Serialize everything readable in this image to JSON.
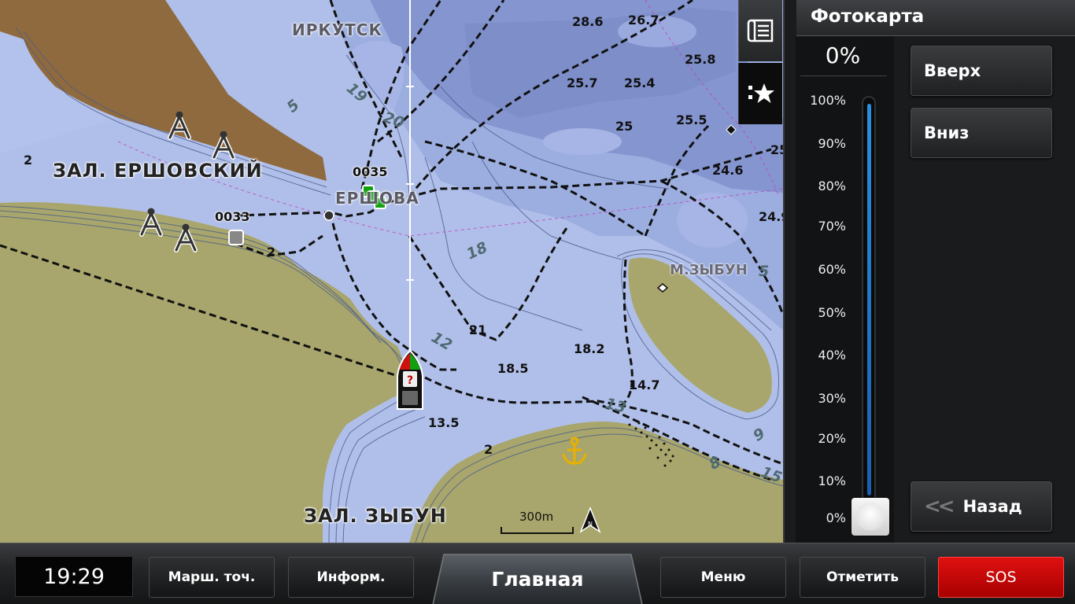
{
  "map": {
    "towns": {
      "irkutsk": "ИРКУТСК",
      "ershova": "ЕРШОВА"
    },
    "bays": {
      "ershovsky": "ЗАЛ. ЕРШОВСКИЙ",
      "zybun": "ЗАЛ. ЗЫБУН"
    },
    "capes": {
      "zybun": "М.ЗЫБУН"
    },
    "waypoints": {
      "wp1": "0035",
      "wp2": "0033"
    },
    "depths": [
      "28.6",
      "26.7",
      "25.8",
      "25.7",
      "25.4",
      "25",
      "25.5",
      "24.6",
      "25",
      "24.9",
      "21",
      "18.2",
      "18.5",
      "14.7",
      "13.5",
      "2",
      "2",
      "2"
    ],
    "contours": [
      "5",
      "19",
      "20",
      "18",
      "12",
      "13",
      "9",
      "8",
      "15",
      "5"
    ],
    "scale": "300m",
    "colors": {
      "water_deep": "#8798d0",
      "water_mid": "#9fb0e0",
      "water_shallow": "#b2c1ec",
      "land": "#a8a66c",
      "photo_land": "#8f6a3e"
    }
  },
  "side_tabs": {
    "layers": "layers-icon",
    "favorites": "favorites-icon"
  },
  "panel": {
    "title": "Фотокарта",
    "percent": "0%",
    "ticks": [
      "100%",
      "90%",
      "80%",
      "70%",
      "60%",
      "50%",
      "40%",
      "30%",
      "20%",
      "10%",
      "0%"
    ],
    "level": 0,
    "up_label": "Вверх",
    "down_label": "Вниз",
    "back_label": "Назад"
  },
  "bottom_bar": {
    "time": "19:29",
    "waypoints_label": "Марш. точ.",
    "info_label": "Информ.",
    "home_label": "Главная",
    "menu_label": "Меню",
    "mark_label": "Отметить",
    "sos_label": "SOS",
    "sos_color": "#d40000"
  }
}
